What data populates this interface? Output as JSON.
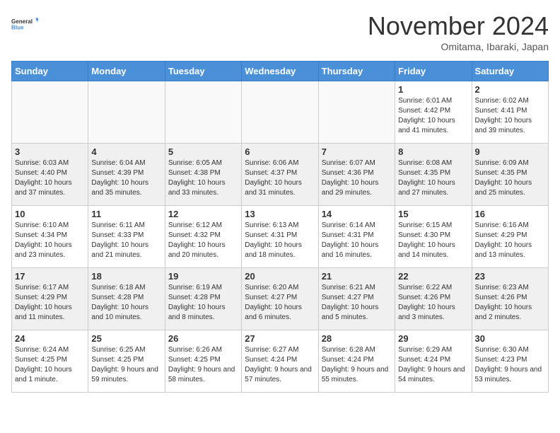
{
  "logo": {
    "line1": "General",
    "line2": "Blue"
  },
  "title": "November 2024",
  "subtitle": "Omitama, Ibaraki, Japan",
  "headers": [
    "Sunday",
    "Monday",
    "Tuesday",
    "Wednesday",
    "Thursday",
    "Friday",
    "Saturday"
  ],
  "weeks": [
    [
      {
        "day": "",
        "info": ""
      },
      {
        "day": "",
        "info": ""
      },
      {
        "day": "",
        "info": ""
      },
      {
        "day": "",
        "info": ""
      },
      {
        "day": "",
        "info": ""
      },
      {
        "day": "1",
        "info": "Sunrise: 6:01 AM\nSunset: 4:42 PM\nDaylight: 10 hours\nand 41 minutes."
      },
      {
        "day": "2",
        "info": "Sunrise: 6:02 AM\nSunset: 4:41 PM\nDaylight: 10 hours\nand 39 minutes."
      }
    ],
    [
      {
        "day": "3",
        "info": "Sunrise: 6:03 AM\nSunset: 4:40 PM\nDaylight: 10 hours\nand 37 minutes."
      },
      {
        "day": "4",
        "info": "Sunrise: 6:04 AM\nSunset: 4:39 PM\nDaylight: 10 hours\nand 35 minutes."
      },
      {
        "day": "5",
        "info": "Sunrise: 6:05 AM\nSunset: 4:38 PM\nDaylight: 10 hours\nand 33 minutes."
      },
      {
        "day": "6",
        "info": "Sunrise: 6:06 AM\nSunset: 4:37 PM\nDaylight: 10 hours\nand 31 minutes."
      },
      {
        "day": "7",
        "info": "Sunrise: 6:07 AM\nSunset: 4:36 PM\nDaylight: 10 hours\nand 29 minutes."
      },
      {
        "day": "8",
        "info": "Sunrise: 6:08 AM\nSunset: 4:35 PM\nDaylight: 10 hours\nand 27 minutes."
      },
      {
        "day": "9",
        "info": "Sunrise: 6:09 AM\nSunset: 4:35 PM\nDaylight: 10 hours\nand 25 minutes."
      }
    ],
    [
      {
        "day": "10",
        "info": "Sunrise: 6:10 AM\nSunset: 4:34 PM\nDaylight: 10 hours\nand 23 minutes."
      },
      {
        "day": "11",
        "info": "Sunrise: 6:11 AM\nSunset: 4:33 PM\nDaylight: 10 hours\nand 21 minutes."
      },
      {
        "day": "12",
        "info": "Sunrise: 6:12 AM\nSunset: 4:32 PM\nDaylight: 10 hours\nand 20 minutes."
      },
      {
        "day": "13",
        "info": "Sunrise: 6:13 AM\nSunset: 4:31 PM\nDaylight: 10 hours\nand 18 minutes."
      },
      {
        "day": "14",
        "info": "Sunrise: 6:14 AM\nSunset: 4:31 PM\nDaylight: 10 hours\nand 16 minutes."
      },
      {
        "day": "15",
        "info": "Sunrise: 6:15 AM\nSunset: 4:30 PM\nDaylight: 10 hours\nand 14 minutes."
      },
      {
        "day": "16",
        "info": "Sunrise: 6:16 AM\nSunset: 4:29 PM\nDaylight: 10 hours\nand 13 minutes."
      }
    ],
    [
      {
        "day": "17",
        "info": "Sunrise: 6:17 AM\nSunset: 4:29 PM\nDaylight: 10 hours\nand 11 minutes."
      },
      {
        "day": "18",
        "info": "Sunrise: 6:18 AM\nSunset: 4:28 PM\nDaylight: 10 hours\nand 10 minutes."
      },
      {
        "day": "19",
        "info": "Sunrise: 6:19 AM\nSunset: 4:28 PM\nDaylight: 10 hours\nand 8 minutes."
      },
      {
        "day": "20",
        "info": "Sunrise: 6:20 AM\nSunset: 4:27 PM\nDaylight: 10 hours\nand 6 minutes."
      },
      {
        "day": "21",
        "info": "Sunrise: 6:21 AM\nSunset: 4:27 PM\nDaylight: 10 hours\nand 5 minutes."
      },
      {
        "day": "22",
        "info": "Sunrise: 6:22 AM\nSunset: 4:26 PM\nDaylight: 10 hours\nand 3 minutes."
      },
      {
        "day": "23",
        "info": "Sunrise: 6:23 AM\nSunset: 4:26 PM\nDaylight: 10 hours\nand 2 minutes."
      }
    ],
    [
      {
        "day": "24",
        "info": "Sunrise: 6:24 AM\nSunset: 4:25 PM\nDaylight: 10 hours\nand 1 minute."
      },
      {
        "day": "25",
        "info": "Sunrise: 6:25 AM\nSunset: 4:25 PM\nDaylight: 9 hours\nand 59 minutes."
      },
      {
        "day": "26",
        "info": "Sunrise: 6:26 AM\nSunset: 4:25 PM\nDaylight: 9 hours\nand 58 minutes."
      },
      {
        "day": "27",
        "info": "Sunrise: 6:27 AM\nSunset: 4:24 PM\nDaylight: 9 hours\nand 57 minutes."
      },
      {
        "day": "28",
        "info": "Sunrise: 6:28 AM\nSunset: 4:24 PM\nDaylight: 9 hours\nand 55 minutes."
      },
      {
        "day": "29",
        "info": "Sunrise: 6:29 AM\nSunset: 4:24 PM\nDaylight: 9 hours\nand 54 minutes."
      },
      {
        "day": "30",
        "info": "Sunrise: 6:30 AM\nSunset: 4:23 PM\nDaylight: 9 hours\nand 53 minutes."
      }
    ]
  ]
}
